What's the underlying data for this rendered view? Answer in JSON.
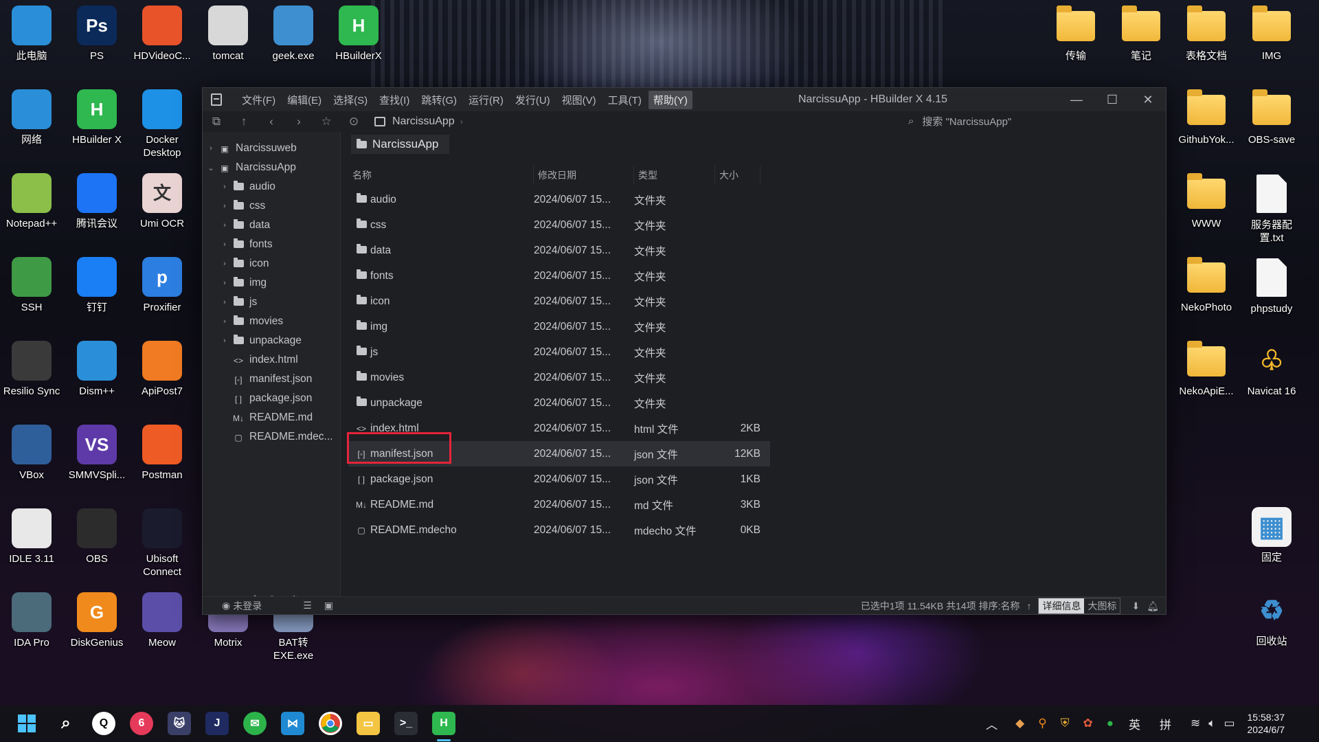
{
  "desktop_left": [
    {
      "label": "此电脑",
      "icon": "monitor-icon",
      "color": "#2a8fd8"
    },
    {
      "label": "PS",
      "icon": "photoshop-icon",
      "color": "#0b2a5a",
      "glyph": "Ps"
    },
    {
      "label": "HDVideoC...",
      "icon": "hdvideo-icon",
      "color": "#e8532a"
    },
    {
      "label": "tomcat",
      "icon": "tomcat-gear-icon",
      "color": "#d8d8d8"
    },
    {
      "label": "geek.exe",
      "icon": "geek-recycle-icon",
      "color": "#3d8fd0"
    },
    {
      "label": "HBuilderX",
      "icon": "hbuilderx-icon",
      "color": "#2eb84f",
      "glyph": "H"
    },
    {
      "label": "网络",
      "icon": "network-icon",
      "color": "#2a8fd8"
    },
    {
      "label": "HBuilder X",
      "icon": "hbuilderx-icon",
      "color": "#2eb84f",
      "glyph": "H"
    },
    {
      "label": "Docker Desktop",
      "icon": "docker-icon",
      "color": "#1d91e6"
    },
    {
      "label": "Notepad++",
      "icon": "notepadpp-icon",
      "color": "#8bbf4a"
    },
    {
      "label": "腾讯会议",
      "icon": "tencent-meeting-icon",
      "color": "#1d74f5"
    },
    {
      "label": "Umi OCR",
      "icon": "umi-ocr-icon",
      "color": "#e9d3d3",
      "glyph": "文"
    },
    {
      "label": "SSH",
      "icon": "ssh-icon",
      "color": "#3f9a46"
    },
    {
      "label": "钉钉",
      "icon": "dingtalk-icon",
      "color": "#1a7ef5"
    },
    {
      "label": "Proxifier",
      "icon": "proxifier-icon",
      "color": "#2c7ee0",
      "glyph": "p"
    },
    {
      "label": "Resilio Sync",
      "icon": "resilio-icon",
      "color": "#3a3a3a"
    },
    {
      "label": "Dism++",
      "icon": "dism-gear-icon",
      "color": "#2a8fd8"
    },
    {
      "label": "ApiPost7",
      "icon": "apipost-icon",
      "color": "#f07b22"
    },
    {
      "label": "VBox",
      "icon": "virtualbox-icon",
      "color": "#2f5f9a"
    },
    {
      "label": "SMMVSpli...",
      "icon": "smmv-icon",
      "color": "#5e3aa8",
      "glyph": "VS"
    },
    {
      "label": "Postman",
      "icon": "postman-icon",
      "color": "#ef5b25"
    },
    {
      "label": "IDLE 3.11",
      "icon": "python-idle-icon",
      "color": "#e8e8e8"
    },
    {
      "label": "OBS",
      "icon": "obs-icon",
      "color": "#2c2c2c"
    },
    {
      "label": "Ubisoft Connect",
      "icon": "ubisoft-icon",
      "color": "#1b1b2e"
    },
    {
      "label": "IDA Pro",
      "icon": "ida-pro-icon",
      "color": "#4b6a7a"
    },
    {
      "label": "DiskGenius",
      "icon": "diskgenius-icon",
      "color": "#f08a1c",
      "glyph": "G"
    },
    {
      "label": "Meow",
      "icon": "meow-cat-icon",
      "color": "#5a4ea8"
    },
    {
      "label": "Motrix",
      "icon": "motrix-icon",
      "color": "#8a7bbf"
    },
    {
      "label": "BAT转 EXE.exe",
      "icon": "bat-exe-icon",
      "color": "#8ba0c8"
    }
  ],
  "desktop_right": [
    {
      "label": "传输",
      "kind": "folder"
    },
    {
      "label": "笔记",
      "kind": "folder"
    },
    {
      "label": "表格文档",
      "kind": "folder"
    },
    {
      "label": "IMG",
      "kind": "folder"
    },
    {
      "label": "GithubYok...",
      "kind": "folder"
    },
    {
      "label": "OBS-save",
      "kind": "folder"
    },
    {
      "label": "WWW",
      "kind": "folder"
    },
    {
      "label": "服务器配置.txt",
      "kind": "doc"
    },
    {
      "label": "NekoPhoto",
      "kind": "folder"
    },
    {
      "label": "phpstudy",
      "kind": "doc"
    },
    {
      "label": "NekoApiE...",
      "kind": "folder"
    },
    {
      "label": "Navicat 16",
      "kind": "navicat"
    },
    {
      "label": "固定",
      "kind": "pin"
    },
    {
      "label": "回收站",
      "kind": "recycle"
    }
  ],
  "window": {
    "title": "NarcissuApp - HBuilder X 4.15",
    "menu": [
      "文件(F)",
      "编辑(E)",
      "选择(S)",
      "查找(I)",
      "跳转(G)",
      "运行(R)",
      "发行(U)",
      "视图(V)",
      "工具(T)",
      "帮助(Y)"
    ],
    "active_menu_index": 9,
    "breadcrumb": "NarcissuApp",
    "search_placeholder": "搜索 \"NarcissuApp\""
  },
  "tree": [
    {
      "label": "Narcissuweb",
      "level": 0,
      "arrow": "›",
      "icon": "project"
    },
    {
      "label": "NarcissuApp",
      "level": 0,
      "arrow": "⌄",
      "icon": "project"
    },
    {
      "label": "audio",
      "level": 1,
      "arrow": "›",
      "icon": "folder"
    },
    {
      "label": "css",
      "level": 1,
      "arrow": "›",
      "icon": "folder"
    },
    {
      "label": "data",
      "level": 1,
      "arrow": "›",
      "icon": "folder"
    },
    {
      "label": "fonts",
      "level": 1,
      "arrow": "›",
      "icon": "folder"
    },
    {
      "label": "icon",
      "level": 1,
      "arrow": "›",
      "icon": "folder"
    },
    {
      "label": "img",
      "level": 1,
      "arrow": "›",
      "icon": "folder"
    },
    {
      "label": "js",
      "level": 1,
      "arrow": "›",
      "icon": "folder"
    },
    {
      "label": "movies",
      "level": 1,
      "arrow": "›",
      "icon": "folder"
    },
    {
      "label": "unpackage",
      "level": 1,
      "arrow": "›",
      "icon": "folder"
    },
    {
      "label": "index.html",
      "level": 1,
      "arrow": "",
      "icon": "html"
    },
    {
      "label": "manifest.json",
      "level": 1,
      "arrow": "",
      "icon": "manifest"
    },
    {
      "label": "package.json",
      "level": 1,
      "arrow": "",
      "icon": "json"
    },
    {
      "label": "README.md",
      "level": 1,
      "arrow": "",
      "icon": "md"
    },
    {
      "label": "README.mdec...",
      "level": 1,
      "arrow": "",
      "icon": "file"
    }
  ],
  "main": {
    "tab_label": "NarcissuApp",
    "columns": {
      "name": "名称",
      "date": "修改日期",
      "type": "类型",
      "size": "大小"
    },
    "files": [
      {
        "name": "audio",
        "date": "2024/06/07 15...",
        "type": "文件夹",
        "size": "",
        "icon": "folder"
      },
      {
        "name": "css",
        "date": "2024/06/07 15...",
        "type": "文件夹",
        "size": "",
        "icon": "folder"
      },
      {
        "name": "data",
        "date": "2024/06/07 15...",
        "type": "文件夹",
        "size": "",
        "icon": "folder"
      },
      {
        "name": "fonts",
        "date": "2024/06/07 15...",
        "type": "文件夹",
        "size": "",
        "icon": "folder"
      },
      {
        "name": "icon",
        "date": "2024/06/07 15...",
        "type": "文件夹",
        "size": "",
        "icon": "folder"
      },
      {
        "name": "img",
        "date": "2024/06/07 15...",
        "type": "文件夹",
        "size": "",
        "icon": "folder"
      },
      {
        "name": "js",
        "date": "2024/06/07 15...",
        "type": "文件夹",
        "size": "",
        "icon": "folder"
      },
      {
        "name": "movies",
        "date": "2024/06/07 15...",
        "type": "文件夹",
        "size": "",
        "icon": "folder"
      },
      {
        "name": "unpackage",
        "date": "2024/06/07 15...",
        "type": "文件夹",
        "size": "",
        "icon": "folder"
      },
      {
        "name": "index.html",
        "date": "2024/06/07 15...",
        "type": "html 文件",
        "size": "2KB",
        "icon": "html"
      },
      {
        "name": "manifest.json",
        "date": "2024/06/07 15...",
        "type": "json 文件",
        "size": "12KB",
        "icon": "manifest",
        "selected": true
      },
      {
        "name": "package.json",
        "date": "2024/06/07 15...",
        "type": "json 文件",
        "size": "1KB",
        "icon": "json"
      },
      {
        "name": "README.md",
        "date": "2024/06/07 15...",
        "type": "md 文件",
        "size": "3KB",
        "icon": "md"
      },
      {
        "name": "README.mdecho",
        "date": "2024/06/07 15...",
        "type": "mdecho 文件",
        "size": "0KB",
        "icon": "file"
      }
    ]
  },
  "status": {
    "login": "未登录",
    "summary": "已选中1项 11.54KB 共14项 排序:名称",
    "view_detail": "详细信息",
    "view_large": "大图标"
  },
  "taskbar": {
    "time": "15:58:37",
    "date": "2024/6/7",
    "ime_lang": "英",
    "ime_mode": "拼"
  },
  "colors": {
    "highlight_box": "#e5243a",
    "hbuilder_green": "#2eb84f"
  }
}
